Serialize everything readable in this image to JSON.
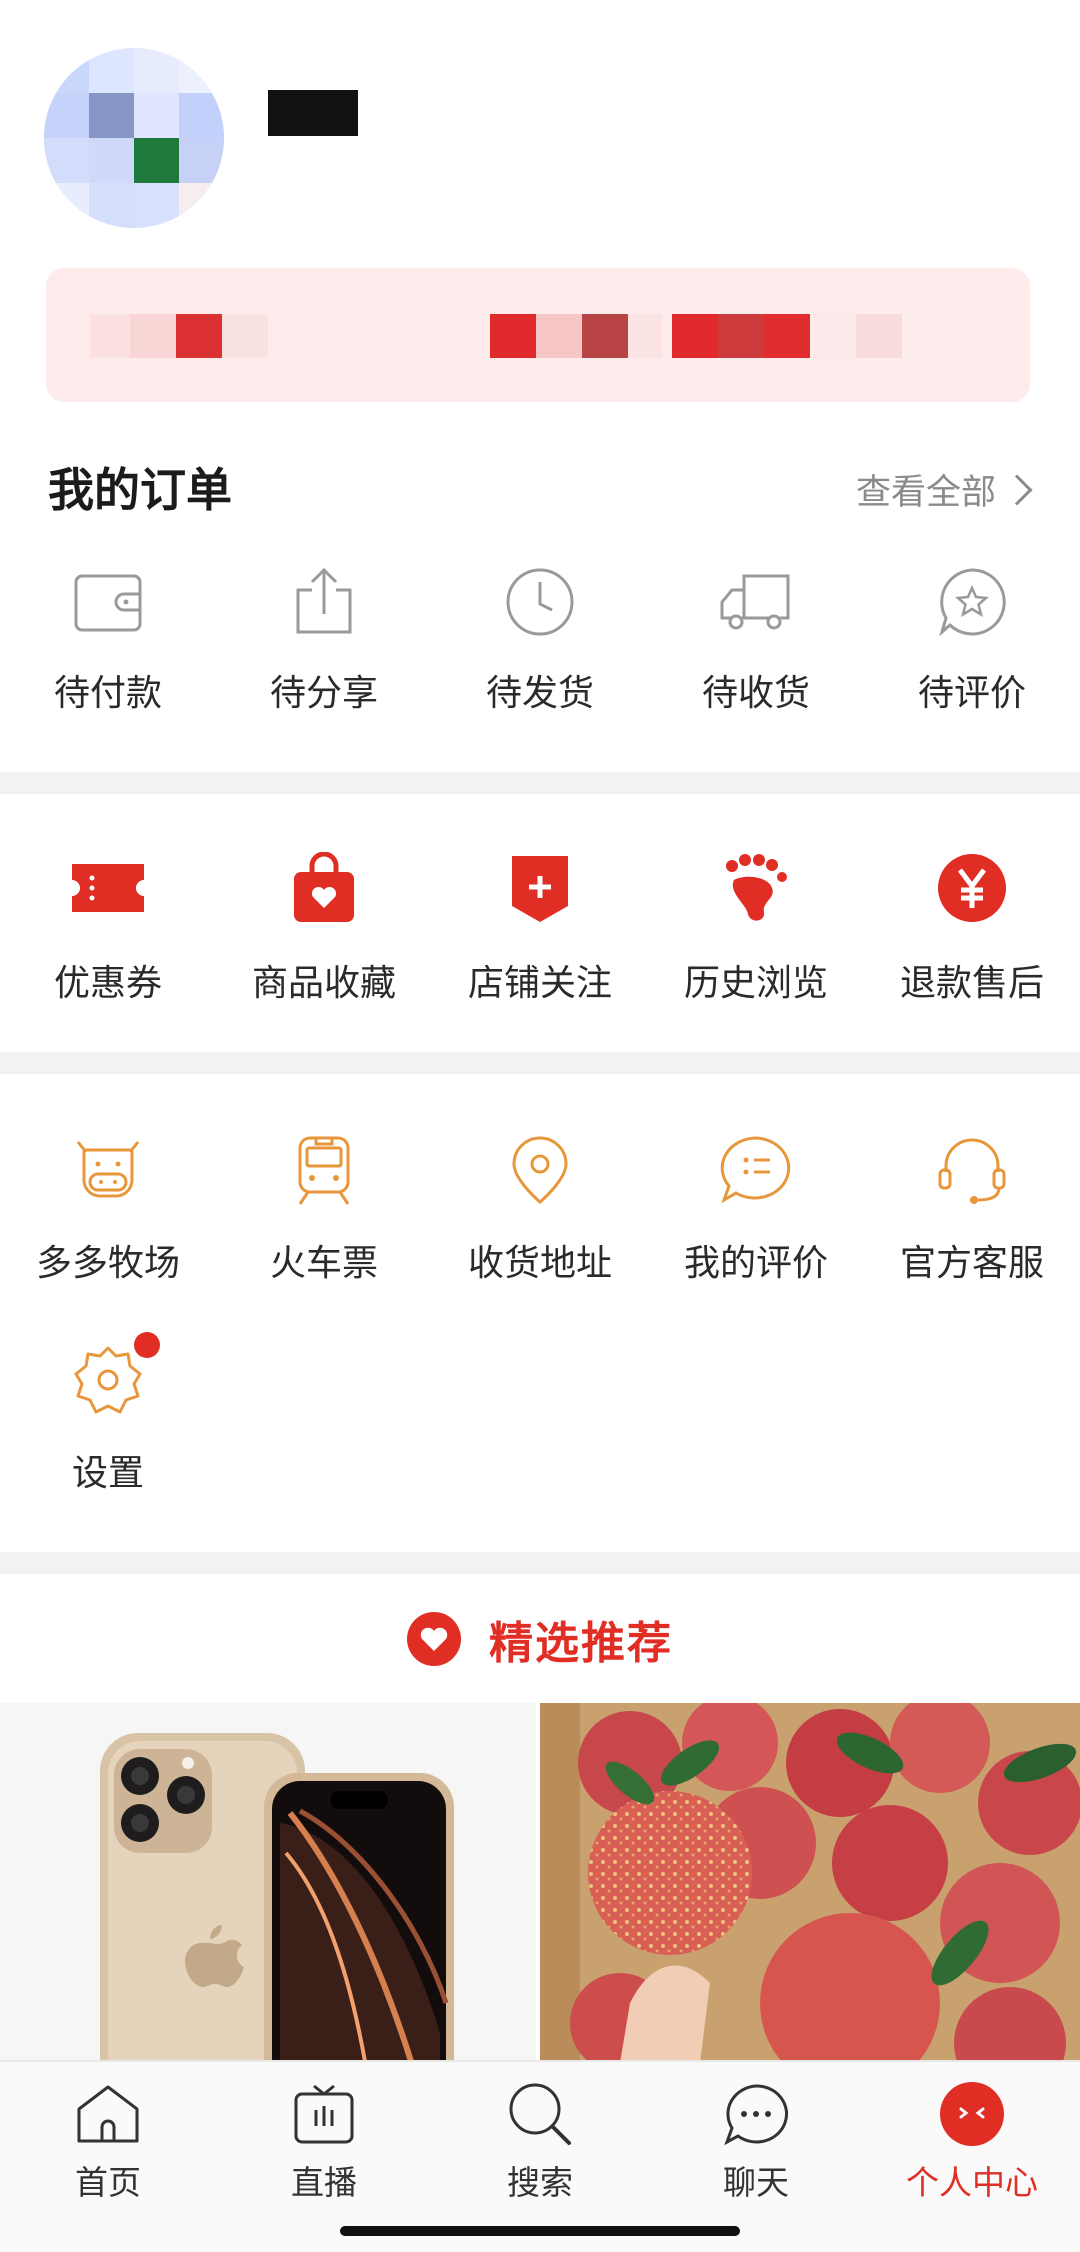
{
  "profile": {
    "avatar_label": "avatar",
    "username": ""
  },
  "orders": {
    "title": "我的订单",
    "view_all": "查看全部",
    "items": [
      {
        "label": "待付款",
        "icon": "wallet-icon"
      },
      {
        "label": "待分享",
        "icon": "share-icon"
      },
      {
        "label": "待发货",
        "icon": "clock-icon"
      },
      {
        "label": "待收货",
        "icon": "truck-icon"
      },
      {
        "label": "待评价",
        "icon": "star-comment-icon"
      }
    ]
  },
  "assets": {
    "items": [
      {
        "label": "优惠券",
        "icon": "coupon-icon"
      },
      {
        "label": "商品收藏",
        "icon": "favorite-bag-icon"
      },
      {
        "label": "店铺关注",
        "icon": "store-follow-icon"
      },
      {
        "label": "历史浏览",
        "icon": "footprint-icon"
      },
      {
        "label": "退款售后",
        "icon": "yuan-icon"
      }
    ]
  },
  "services": {
    "items": [
      {
        "label": "多多牧场",
        "icon": "cow-icon"
      },
      {
        "label": "火车票",
        "icon": "train-icon"
      },
      {
        "label": "收货地址",
        "icon": "location-icon"
      },
      {
        "label": "我的评价",
        "icon": "comment-list-icon"
      },
      {
        "label": "官方客服",
        "icon": "headset-icon"
      }
    ],
    "settings": {
      "label": "设置",
      "icon": "gear-icon",
      "has_badge": true
    }
  },
  "recommend": {
    "title": "精选推荐"
  },
  "tabbar": {
    "items": [
      {
        "label": "首页",
        "icon": "home-icon",
        "active": false
      },
      {
        "label": "直播",
        "icon": "tv-icon",
        "active": false
      },
      {
        "label": "搜索",
        "icon": "search-icon",
        "active": false
      },
      {
        "label": "聊天",
        "icon": "chat-icon",
        "active": false
      },
      {
        "label": "个人中心",
        "icon": "profile-icon",
        "active": true
      }
    ]
  },
  "colors": {
    "accent": "#e02e24",
    "orange_icon": "#e8963a",
    "gray_icon": "#9a9a9a"
  }
}
